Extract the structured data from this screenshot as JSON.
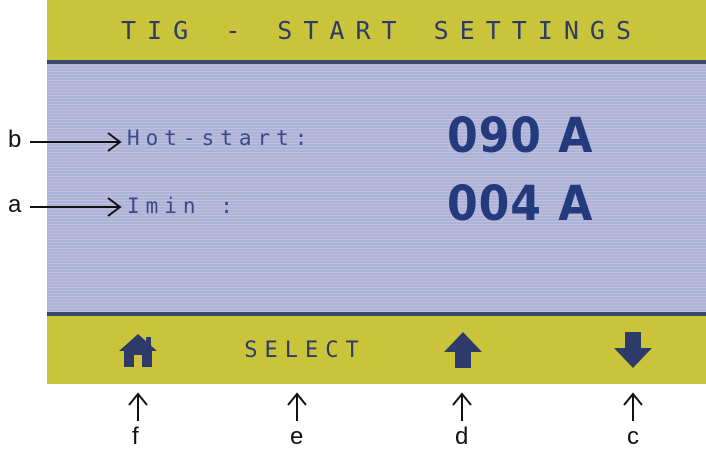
{
  "screen": {
    "title": "TIG - START SETTINGS",
    "rows": [
      {
        "label": "Hot-start:",
        "value": "090 A"
      },
      {
        "label": "Imin :",
        "value": "004 A"
      }
    ],
    "footer": {
      "home_icon": "home-icon",
      "select_label": "SELECT",
      "up_icon": "arrow-up-icon",
      "down_icon": "arrow-down-icon"
    }
  },
  "callouts": {
    "b": "b",
    "a": "a",
    "f": "f",
    "e": "e",
    "d": "d",
    "c": "c"
  },
  "colors": {
    "bar_yellow": "#c9c43a",
    "panel_lavender": "#b4b8dc",
    "text_blue": "#2e3a6a",
    "value_blue": "#233a7c"
  }
}
